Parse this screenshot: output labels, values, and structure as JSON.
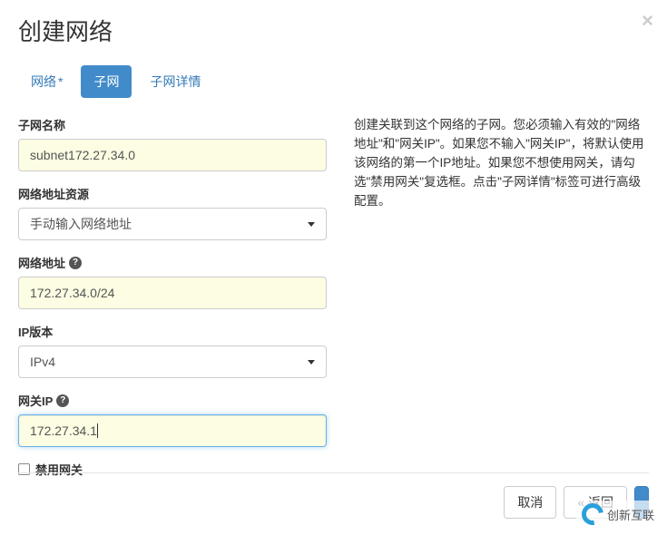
{
  "modal": {
    "title": "创建网络",
    "close": "×"
  },
  "tabs": {
    "network": "网络",
    "asterisk": "*",
    "subnet": "子网",
    "subnet_detail": "子网详情"
  },
  "form": {
    "subnet_name_label": "子网名称",
    "subnet_name_value": "subnet172.27.34.0",
    "addr_source_label": "网络地址资源",
    "addr_source_value": "手动输入网络地址",
    "network_addr_label": "网络地址",
    "network_addr_value": "172.27.34.0/24",
    "ip_version_label": "IP版本",
    "ip_version_value": "IPv4",
    "gateway_ip_label": "网关IP",
    "gateway_ip_value": "172.27.34.1",
    "disable_gateway_label": "禁用网关"
  },
  "help": {
    "text": "创建关联到这个网络的子网。您必须输入有效的\"网络地址\"和\"网关IP\"。如果您不输入\"网关IP\"，将默认使用该网络的第一个IP地址。如果您不想使用网关，请勾选\"禁用网关\"复选框。点击\"子网详情\"标签可进行高级配置。"
  },
  "buttons": {
    "cancel": "取消",
    "back": "« 返回"
  },
  "watermark": "创新互联"
}
